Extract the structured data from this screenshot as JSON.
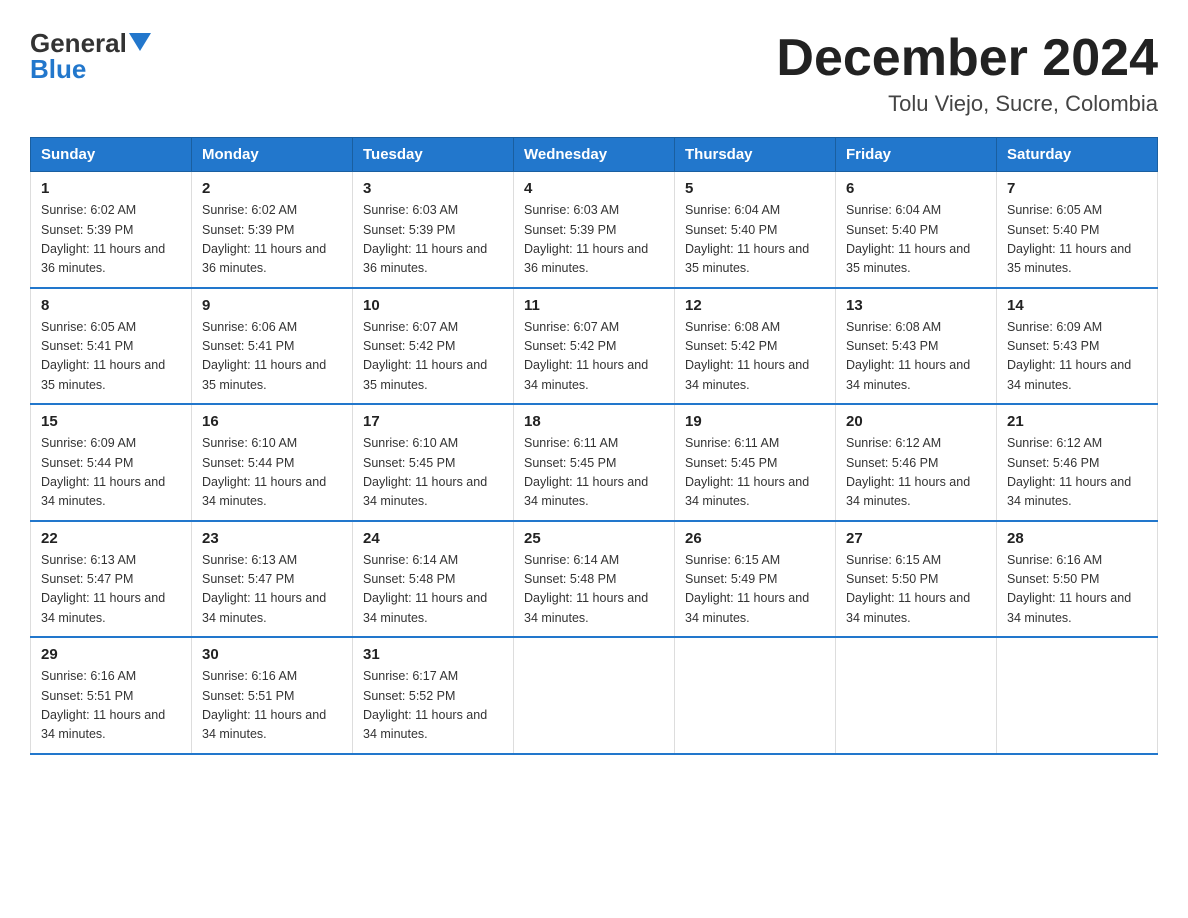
{
  "logo": {
    "general": "General",
    "blue": "Blue"
  },
  "header": {
    "month": "December 2024",
    "location": "Tolu Viejo, Sucre, Colombia"
  },
  "days_of_week": [
    "Sunday",
    "Monday",
    "Tuesday",
    "Wednesday",
    "Thursday",
    "Friday",
    "Saturday"
  ],
  "weeks": [
    [
      {
        "day": "1",
        "sunrise": "6:02 AM",
        "sunset": "5:39 PM",
        "daylight": "11 hours and 36 minutes."
      },
      {
        "day": "2",
        "sunrise": "6:02 AM",
        "sunset": "5:39 PM",
        "daylight": "11 hours and 36 minutes."
      },
      {
        "day": "3",
        "sunrise": "6:03 AM",
        "sunset": "5:39 PM",
        "daylight": "11 hours and 36 minutes."
      },
      {
        "day": "4",
        "sunrise": "6:03 AM",
        "sunset": "5:39 PM",
        "daylight": "11 hours and 36 minutes."
      },
      {
        "day": "5",
        "sunrise": "6:04 AM",
        "sunset": "5:40 PM",
        "daylight": "11 hours and 35 minutes."
      },
      {
        "day": "6",
        "sunrise": "6:04 AM",
        "sunset": "5:40 PM",
        "daylight": "11 hours and 35 minutes."
      },
      {
        "day": "7",
        "sunrise": "6:05 AM",
        "sunset": "5:40 PM",
        "daylight": "11 hours and 35 minutes."
      }
    ],
    [
      {
        "day": "8",
        "sunrise": "6:05 AM",
        "sunset": "5:41 PM",
        "daylight": "11 hours and 35 minutes."
      },
      {
        "day": "9",
        "sunrise": "6:06 AM",
        "sunset": "5:41 PM",
        "daylight": "11 hours and 35 minutes."
      },
      {
        "day": "10",
        "sunrise": "6:07 AM",
        "sunset": "5:42 PM",
        "daylight": "11 hours and 35 minutes."
      },
      {
        "day": "11",
        "sunrise": "6:07 AM",
        "sunset": "5:42 PM",
        "daylight": "11 hours and 34 minutes."
      },
      {
        "day": "12",
        "sunrise": "6:08 AM",
        "sunset": "5:42 PM",
        "daylight": "11 hours and 34 minutes."
      },
      {
        "day": "13",
        "sunrise": "6:08 AM",
        "sunset": "5:43 PM",
        "daylight": "11 hours and 34 minutes."
      },
      {
        "day": "14",
        "sunrise": "6:09 AM",
        "sunset": "5:43 PM",
        "daylight": "11 hours and 34 minutes."
      }
    ],
    [
      {
        "day": "15",
        "sunrise": "6:09 AM",
        "sunset": "5:44 PM",
        "daylight": "11 hours and 34 minutes."
      },
      {
        "day": "16",
        "sunrise": "6:10 AM",
        "sunset": "5:44 PM",
        "daylight": "11 hours and 34 minutes."
      },
      {
        "day": "17",
        "sunrise": "6:10 AM",
        "sunset": "5:45 PM",
        "daylight": "11 hours and 34 minutes."
      },
      {
        "day": "18",
        "sunrise": "6:11 AM",
        "sunset": "5:45 PM",
        "daylight": "11 hours and 34 minutes."
      },
      {
        "day": "19",
        "sunrise": "6:11 AM",
        "sunset": "5:45 PM",
        "daylight": "11 hours and 34 minutes."
      },
      {
        "day": "20",
        "sunrise": "6:12 AM",
        "sunset": "5:46 PM",
        "daylight": "11 hours and 34 minutes."
      },
      {
        "day": "21",
        "sunrise": "6:12 AM",
        "sunset": "5:46 PM",
        "daylight": "11 hours and 34 minutes."
      }
    ],
    [
      {
        "day": "22",
        "sunrise": "6:13 AM",
        "sunset": "5:47 PM",
        "daylight": "11 hours and 34 minutes."
      },
      {
        "day": "23",
        "sunrise": "6:13 AM",
        "sunset": "5:47 PM",
        "daylight": "11 hours and 34 minutes."
      },
      {
        "day": "24",
        "sunrise": "6:14 AM",
        "sunset": "5:48 PM",
        "daylight": "11 hours and 34 minutes."
      },
      {
        "day": "25",
        "sunrise": "6:14 AM",
        "sunset": "5:48 PM",
        "daylight": "11 hours and 34 minutes."
      },
      {
        "day": "26",
        "sunrise": "6:15 AM",
        "sunset": "5:49 PM",
        "daylight": "11 hours and 34 minutes."
      },
      {
        "day": "27",
        "sunrise": "6:15 AM",
        "sunset": "5:50 PM",
        "daylight": "11 hours and 34 minutes."
      },
      {
        "day": "28",
        "sunrise": "6:16 AM",
        "sunset": "5:50 PM",
        "daylight": "11 hours and 34 minutes."
      }
    ],
    [
      {
        "day": "29",
        "sunrise": "6:16 AM",
        "sunset": "5:51 PM",
        "daylight": "11 hours and 34 minutes."
      },
      {
        "day": "30",
        "sunrise": "6:16 AM",
        "sunset": "5:51 PM",
        "daylight": "11 hours and 34 minutes."
      },
      {
        "day": "31",
        "sunrise": "6:17 AM",
        "sunset": "5:52 PM",
        "daylight": "11 hours and 34 minutes."
      },
      null,
      null,
      null,
      null
    ]
  ]
}
